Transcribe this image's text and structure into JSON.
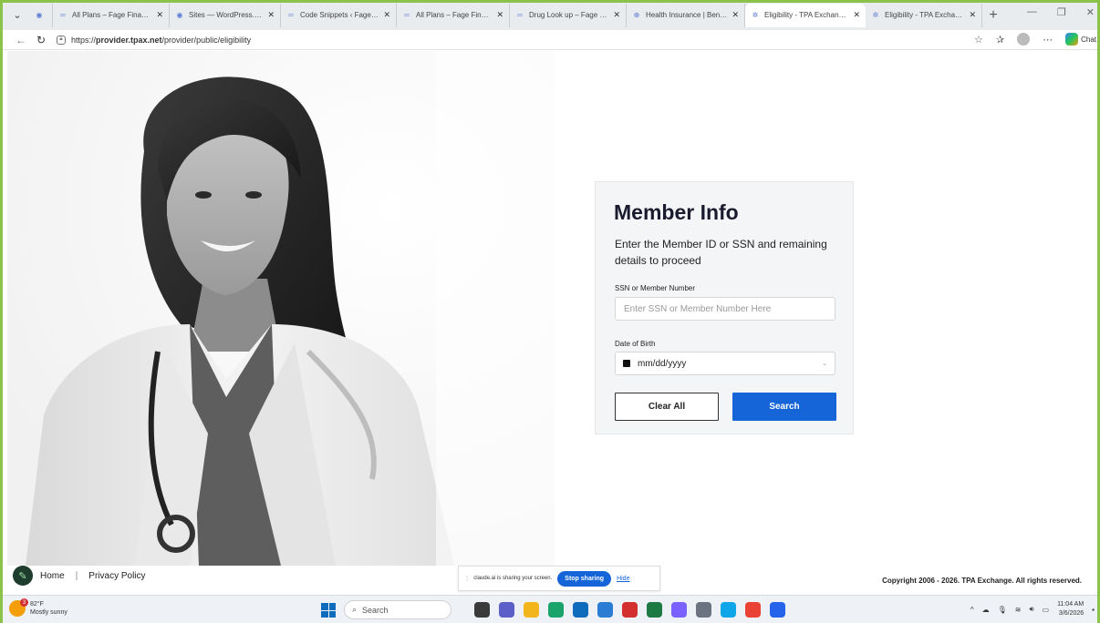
{
  "browser": {
    "tabs": [
      {
        "label": "",
        "icon": "wordpress-icon",
        "active": false
      },
      {
        "label": "All Plans – Fage Financial",
        "icon": "page-icon",
        "active": false
      },
      {
        "label": "Sites — WordPress.com",
        "icon": "wordpress-icon",
        "active": false
      },
      {
        "label": "Code Snippets ‹ Fage Finan",
        "icon": "page-icon",
        "active": false
      },
      {
        "label": "All Plans – Fage Financial",
        "icon": "page-icon",
        "active": false
      },
      {
        "label": "Drug Look up – Fage Finan",
        "icon": "page-icon",
        "active": false
      },
      {
        "label": "Health Insurance | Benefit",
        "icon": "globe-icon",
        "active": false
      },
      {
        "label": "Eligibility - TPA Exchange H",
        "icon": "tpa-icon",
        "active": true
      },
      {
        "label": "Eligibility - TPA Exchange H",
        "icon": "tpa-icon",
        "active": false
      }
    ],
    "url_prefix": "https://",
    "url_host": "provider.tpax.net",
    "url_path": "/provider/public/eligibility",
    "chat_label": "Chat"
  },
  "card": {
    "title": "Member Info",
    "subtitle": "Enter the Member ID or SSN and remaining details to proceed",
    "ssn_label": "SSN or Member Number",
    "ssn_placeholder": "Enter SSN or Member Number Here",
    "ssn_value": "",
    "dob_label": "Date of Birth",
    "dob_value": "mm/dd/yyyy",
    "clear_label": "Clear All",
    "search_label": "Search",
    "accent_color": "#1565d8"
  },
  "footer": {
    "home": "Home",
    "separator": "|",
    "privacy": "Privacy Policy",
    "copyright": "Copyright 2006 - 2026. TPA Exchange. All rights reserved."
  },
  "share_bar": {
    "message": "claude.ai is sharing your screen.",
    "stop_label": "Stop sharing",
    "hide_label": "Hide"
  },
  "taskbar": {
    "weather_badge": "3",
    "temperature": "82°F",
    "condition": "Mostly sunny",
    "search_label": "Search",
    "time": "11:04 AM",
    "date": "3/6/2026"
  }
}
